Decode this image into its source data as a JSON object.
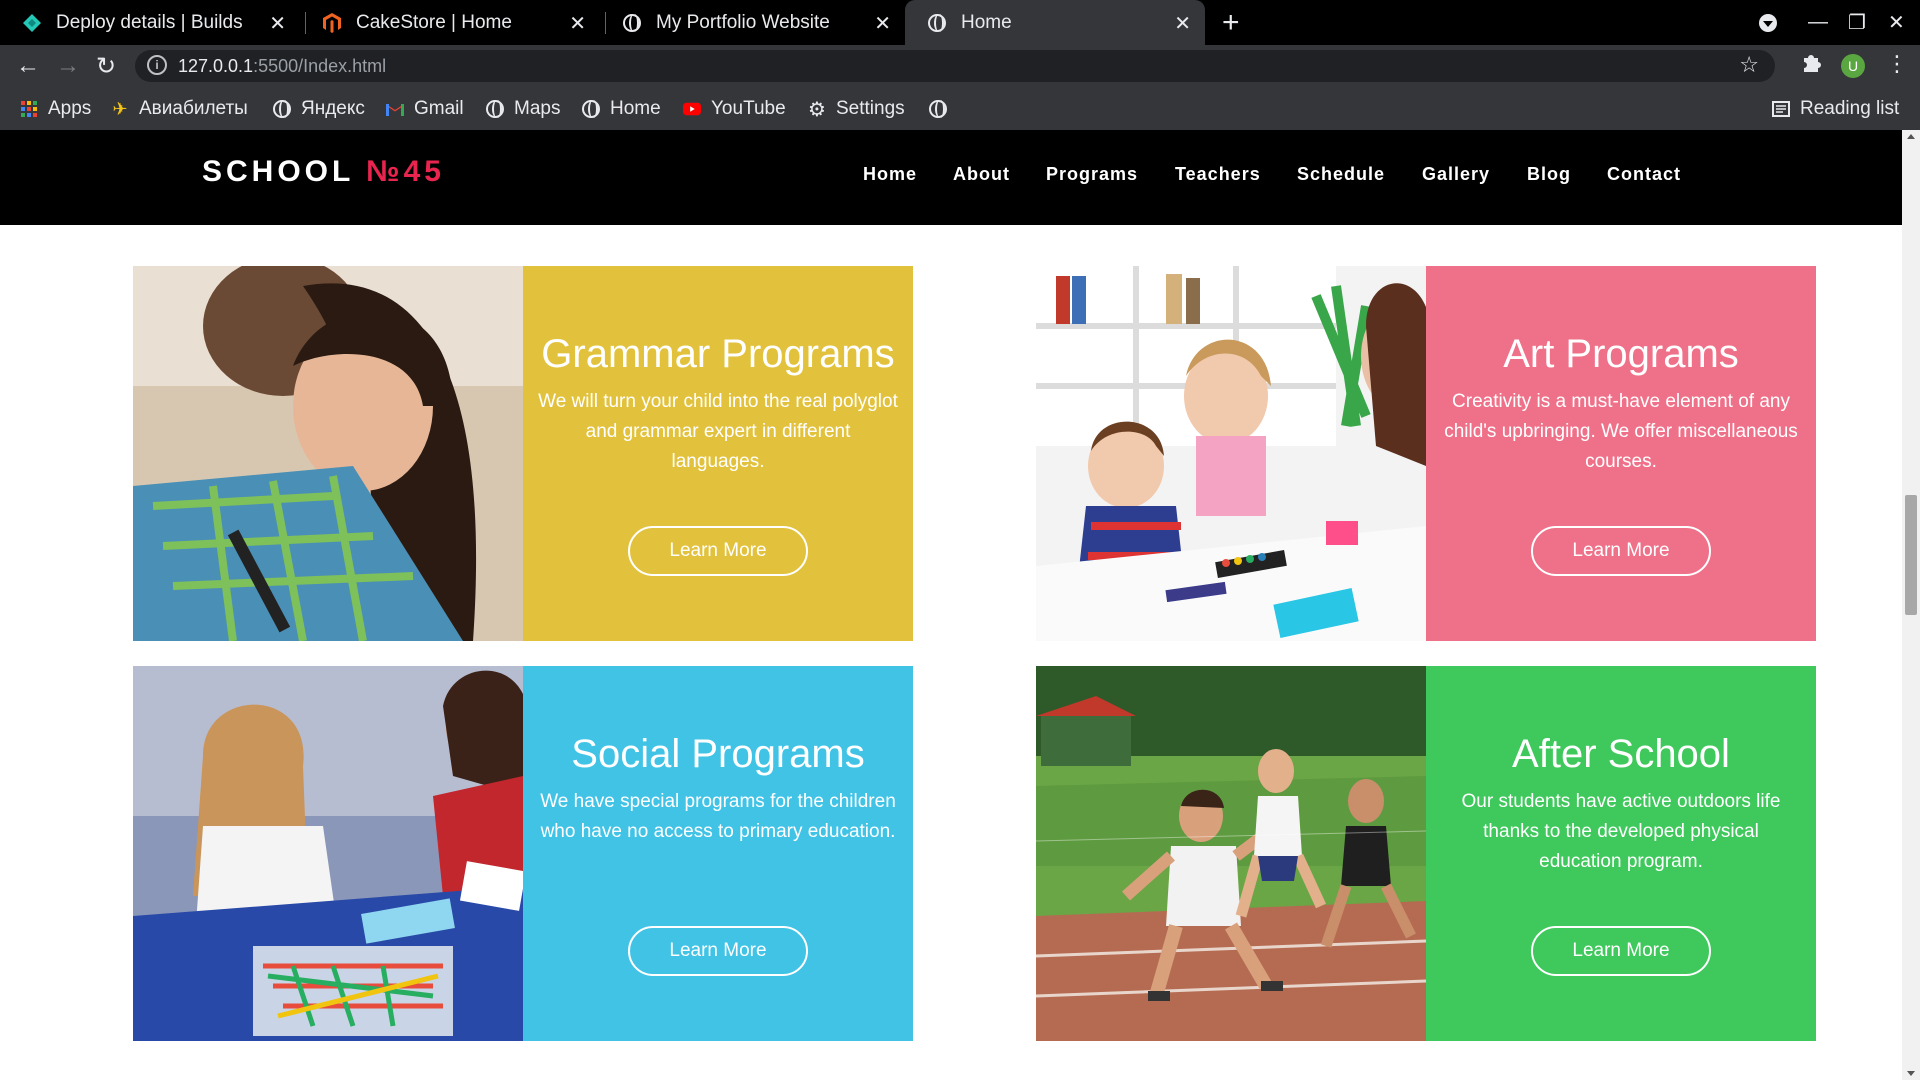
{
  "browser": {
    "tabs": [
      {
        "title": "Deploy details | Builds",
        "icon": "netlify-icon",
        "active": false
      },
      {
        "title": "CakeStore | Home",
        "icon": "magento-icon",
        "active": false
      },
      {
        "title": "My Portfolio Website",
        "icon": "globe-icon",
        "active": false
      },
      {
        "title": "Home",
        "icon": "globe-icon",
        "active": true
      }
    ],
    "url_host": "127.0.0.1",
    "url_path": ":5500/Index.html",
    "avatar_letter": "U",
    "bookmarks": [
      {
        "label": "Apps",
        "icon": "apps-grid-icon"
      },
      {
        "label": "Авиабилеты",
        "icon": "plane-icon"
      },
      {
        "label": "Яндекс",
        "icon": "globe-icon"
      },
      {
        "label": "Gmail",
        "icon": "gmail-icon"
      },
      {
        "label": "Maps",
        "icon": "globe-icon"
      },
      {
        "label": "Home",
        "icon": "globe-icon"
      },
      {
        "label": "YouTube",
        "icon": "youtube-icon"
      },
      {
        "label": "Settings",
        "icon": "gear-icon"
      }
    ],
    "reading_list": "Reading list"
  },
  "site": {
    "logo_text": "SCHOOL",
    "logo_number": "№45",
    "logo_number_color": "#e8244f",
    "nav": [
      "Home",
      "About",
      "Programs",
      "Teachers",
      "Schedule",
      "Gallery",
      "Blog",
      "Contact"
    ]
  },
  "programs": [
    {
      "title": "Grammar Programs",
      "text": "We will turn your child into the real polyglot and grammar expert in different languages.",
      "button": "Learn More",
      "color": "#e3c23a"
    },
    {
      "title": "Art Programs",
      "text": "Creativity is a must-have element of any child's upbringing. We offer miscellaneous courses.",
      "button": "Learn More",
      "color": "#ee6f86"
    },
    {
      "title": "Social Programs",
      "text": "We have special programs for the children who have no access to primary education.",
      "button": "Learn More",
      "color": "#3ec3e6"
    },
    {
      "title": "After School",
      "text": "Our students have active outdoors life thanks to the developed physical education program.",
      "button": "Learn More",
      "color": "#34c452"
    }
  ]
}
